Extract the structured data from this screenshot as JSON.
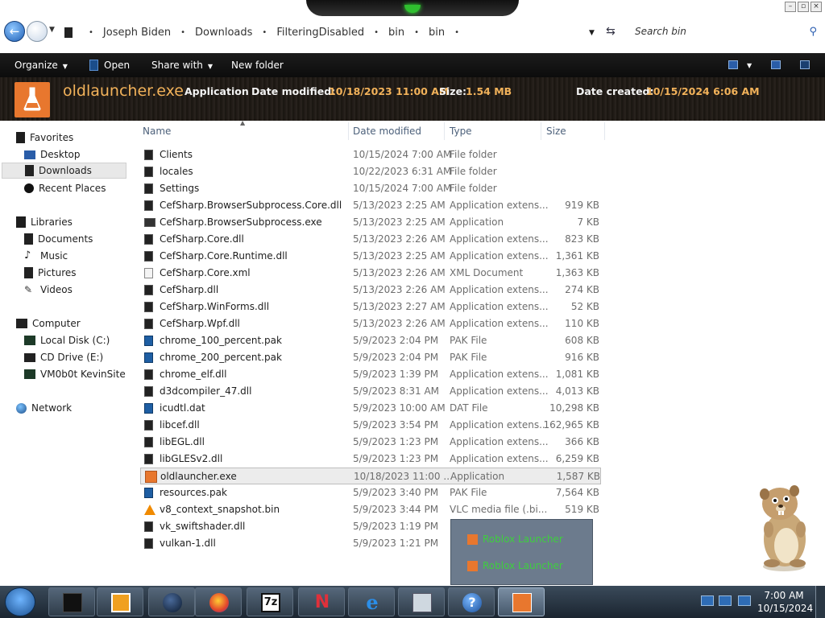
{
  "address": {
    "crumbs": [
      "Joseph Biden",
      "Downloads",
      "FilteringDisabled",
      "bin",
      "bin"
    ],
    "search_placeholder": "Search bin"
  },
  "commandbar": {
    "organize": "Organize",
    "open": "Open",
    "share_with": "Share with",
    "new_folder": "New folder"
  },
  "details": {
    "name": "oldlauncher.exe",
    "type": "Application",
    "modified_label": "Date modified:",
    "modified_value": "10/18/2023 11:00 AM",
    "size_label": "Size:",
    "size_value": "1.54 MB",
    "created_label": "Date created:",
    "created_value": "10/15/2024 6:06 AM"
  },
  "nav": {
    "favorites": "Favorites",
    "desktop": "Desktop",
    "downloads": "Downloads",
    "recent_places": "Recent Places",
    "libraries": "Libraries",
    "documents": "Documents",
    "music": "Music",
    "pictures": "Pictures",
    "videos": "Videos",
    "computer": "Computer",
    "local_disk": "Local Disk (C:)",
    "cd_drive": "CD Drive (E:)",
    "network_drive": "VM0b0t KevinSite",
    "network": "Network"
  },
  "columns": {
    "name": "Name",
    "date_modified": "Date modified",
    "type": "Type",
    "size": "Size"
  },
  "files": [
    {
      "name": "Clients",
      "date": "10/15/2024 7:00 AM",
      "type": "File folder",
      "size": "",
      "icon": "folder"
    },
    {
      "name": "locales",
      "date": "10/22/2023 6:31 AM",
      "type": "File folder",
      "size": "",
      "icon": "folder"
    },
    {
      "name": "Settings",
      "date": "10/15/2024 7:00 AM",
      "type": "File folder",
      "size": "",
      "icon": "folder"
    },
    {
      "name": "CefSharp.BrowserSubprocess.Core.dll",
      "date": "5/13/2023 2:25 AM",
      "type": "Application extens...",
      "size": "919 KB",
      "icon": "dll"
    },
    {
      "name": "CefSharp.BrowserSubprocess.exe",
      "date": "5/13/2023 2:25 AM",
      "type": "Application",
      "size": "7 KB",
      "icon": "exe"
    },
    {
      "name": "CefSharp.Core.dll",
      "date": "5/13/2023 2:26 AM",
      "type": "Application extens...",
      "size": "823 KB",
      "icon": "dll"
    },
    {
      "name": "CefSharp.Core.Runtime.dll",
      "date": "5/13/2023 2:25 AM",
      "type": "Application extens...",
      "size": "1,361 KB",
      "icon": "dll"
    },
    {
      "name": "CefSharp.Core.xml",
      "date": "5/13/2023 2:26 AM",
      "type": "XML Document",
      "size": "1,363 KB",
      "icon": "xml"
    },
    {
      "name": "CefSharp.dll",
      "date": "5/13/2023 2:26 AM",
      "type": "Application extens...",
      "size": "274 KB",
      "icon": "dll"
    },
    {
      "name": "CefSharp.WinForms.dll",
      "date": "5/13/2023 2:27 AM",
      "type": "Application extens...",
      "size": "52 KB",
      "icon": "dll"
    },
    {
      "name": "CefSharp.Wpf.dll",
      "date": "5/13/2023 2:26 AM",
      "type": "Application extens...",
      "size": "110 KB",
      "icon": "dll"
    },
    {
      "name": "chrome_100_percent.pak",
      "date": "5/9/2023 2:04 PM",
      "type": "PAK File",
      "size": "608 KB",
      "icon": "blue"
    },
    {
      "name": "chrome_200_percent.pak",
      "date": "5/9/2023 2:04 PM",
      "type": "PAK File",
      "size": "916 KB",
      "icon": "blue"
    },
    {
      "name": "chrome_elf.dll",
      "date": "5/9/2023 1:39 PM",
      "type": "Application extens...",
      "size": "1,081 KB",
      "icon": "dll"
    },
    {
      "name": "d3dcompiler_47.dll",
      "date": "5/9/2023 8:31 AM",
      "type": "Application extens...",
      "size": "4,013 KB",
      "icon": "dll"
    },
    {
      "name": "icudtl.dat",
      "date": "5/9/2023 10:00 AM",
      "type": "DAT File",
      "size": "10,298 KB",
      "icon": "blue"
    },
    {
      "name": "libcef.dll",
      "date": "5/9/2023 3:54 PM",
      "type": "Application extens...",
      "size": "162,965 KB",
      "icon": "dll"
    },
    {
      "name": "libEGL.dll",
      "date": "5/9/2023 1:23 PM",
      "type": "Application extens...",
      "size": "366 KB",
      "icon": "dll"
    },
    {
      "name": "libGLESv2.dll",
      "date": "5/9/2023 1:23 PM",
      "type": "Application extens...",
      "size": "6,259 KB",
      "icon": "dll"
    },
    {
      "name": "oldlauncher.exe",
      "date": "10/18/2023 11:00 ...",
      "type": "Application",
      "size": "1,587 KB",
      "icon": "lab",
      "selected": true
    },
    {
      "name": "resources.pak",
      "date": "5/9/2023 3:40 PM",
      "type": "PAK File",
      "size": "7,564 KB",
      "icon": "blue"
    },
    {
      "name": "v8_context_snapshot.bin",
      "date": "5/9/2023 3:44 PM",
      "type": "VLC media file (.bi...",
      "size": "519 KB",
      "icon": "vlc"
    },
    {
      "name": "vk_swiftshader.dll",
      "date": "5/9/2023 1:19 PM",
      "type": "",
      "size": "",
      "icon": "dll"
    },
    {
      "name": "vulkan-1.dll",
      "date": "5/9/2023 1:21 PM",
      "type": "",
      "size": "",
      "icon": "dll"
    }
  ],
  "popup": {
    "items": [
      "Roblox Launcher",
      "Roblox Launcher"
    ]
  },
  "taskbar": {
    "time": "7:00 AM",
    "date": "10/15/2024"
  },
  "colors": {
    "accent_orange": "#f2b25a",
    "icon_orange": "#e8772e",
    "popup_green": "#3ecf3e"
  }
}
